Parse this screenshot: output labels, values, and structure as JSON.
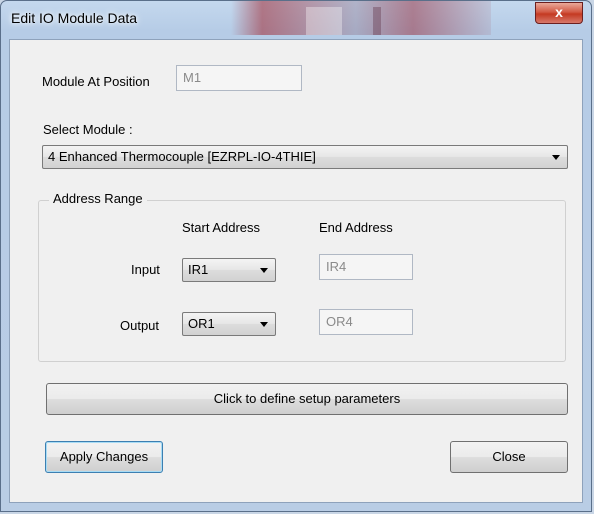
{
  "window": {
    "title": "Edit IO Module Data",
    "close_glyph": "x"
  },
  "module_position": {
    "label": "Module At Position",
    "value": "M1"
  },
  "select_module": {
    "label": "Select Module :",
    "selected": "4 Enhanced Thermocouple [EZRPL-IO-4THIE]"
  },
  "address_range": {
    "title": "Address Range",
    "start_header": "Start Address",
    "end_header": "End Address",
    "input": {
      "label": "Input",
      "start": "IR1",
      "end": "IR4"
    },
    "output": {
      "label": "Output",
      "start": "OR1",
      "end": "OR4"
    }
  },
  "buttons": {
    "setup": "Click to define setup parameters",
    "apply": "Apply Changes",
    "close": "Close"
  }
}
